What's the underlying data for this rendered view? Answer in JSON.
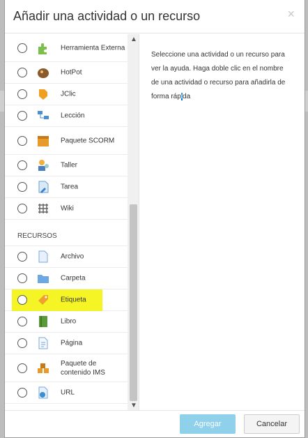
{
  "dialog": {
    "title": "Añadir una actividad o un recurso",
    "close_icon": "×"
  },
  "activities": [
    {
      "label": "Herramienta Externa",
      "icon": "puzzle-icon",
      "tall": true
    },
    {
      "label": "HotPot",
      "icon": "hotpot-icon"
    },
    {
      "label": "JClic",
      "icon": "jclic-icon"
    },
    {
      "label": "Lección",
      "icon": "lesson-icon"
    },
    {
      "label": "Paquete SCORM",
      "icon": "scorm-icon",
      "tall": true
    },
    {
      "label": "Taller",
      "icon": "workshop-icon"
    },
    {
      "label": "Tarea",
      "icon": "assignment-icon"
    },
    {
      "label": "Wiki",
      "icon": "wiki-icon"
    }
  ],
  "resources_heading": "RECURSOS",
  "resources": [
    {
      "label": "Archivo",
      "icon": "file-icon"
    },
    {
      "label": "Carpeta",
      "icon": "folder-icon"
    },
    {
      "label": "Etiqueta",
      "icon": "label-icon",
      "highlighted": true
    },
    {
      "label": "Libro",
      "icon": "book-icon"
    },
    {
      "label": "Página",
      "icon": "page-icon"
    },
    {
      "label": "Paquete de contenido IMS",
      "icon": "ims-icon",
      "tall": true
    },
    {
      "label": "URL",
      "icon": "url-icon"
    }
  ],
  "help_text_before": "Seleccione una actividad o un recurso para ver la ayuda. Haga doble clic en el nombre de una actividad o recurso para añadirla de forma ráp",
  "help_text_caret": "i",
  "help_text_after": "da",
  "scroll": {
    "up": "▲",
    "down": "▼"
  },
  "buttons": {
    "add": "Agregar",
    "cancel": "Cancelar"
  }
}
